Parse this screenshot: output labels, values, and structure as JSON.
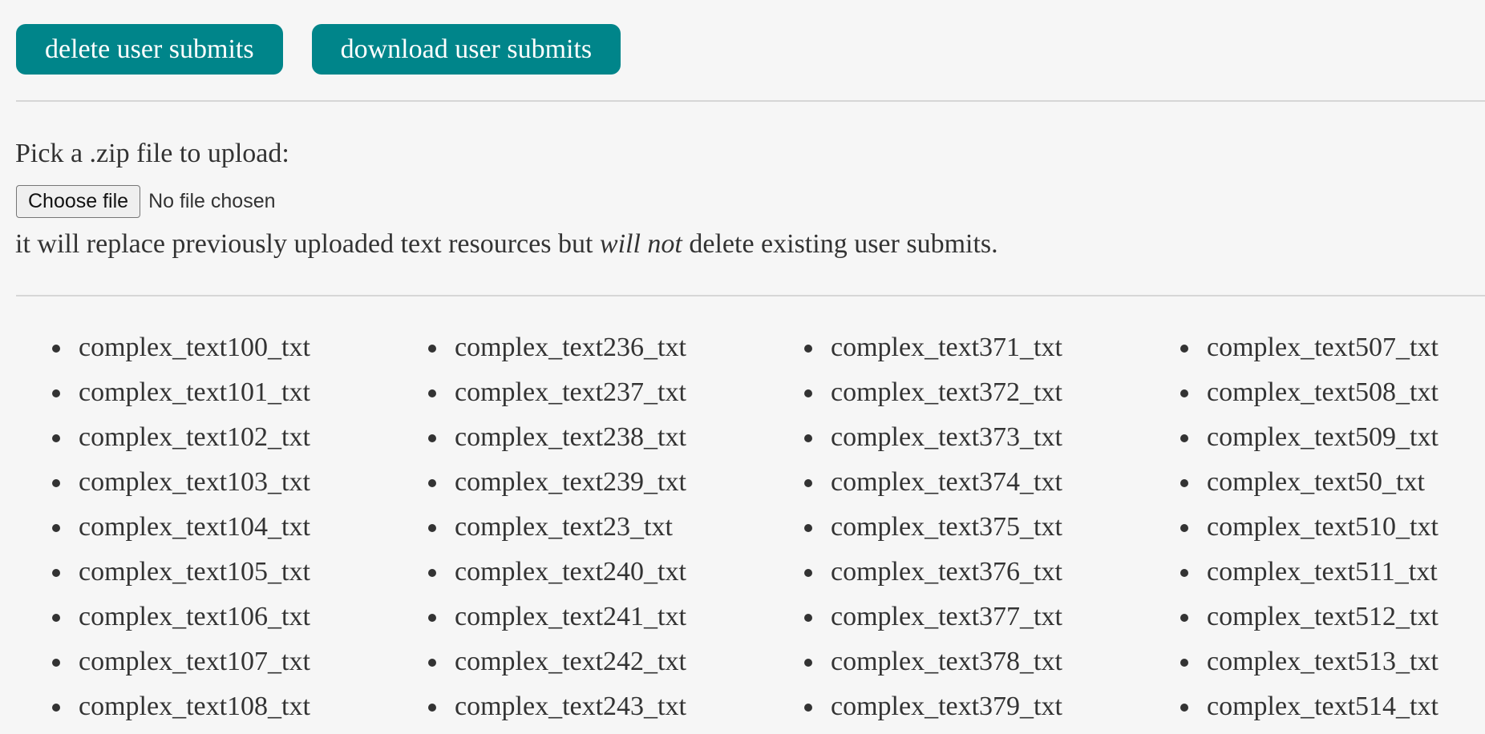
{
  "toolbar": {
    "delete_label": "delete user submits",
    "download_label": "download user submits"
  },
  "upload": {
    "prompt": "Pick a .zip file to upload:",
    "choose_label": "Choose file",
    "status": "No file chosen",
    "note_before": "it will replace previously uploaded text resources but ",
    "note_em": "will not",
    "note_after": " delete existing user submits."
  },
  "colors": {
    "accent": "#00858a",
    "background": "#f6f6f6",
    "text": "#333333"
  },
  "files": {
    "col1": [
      "complex_text100_txt",
      "complex_text101_txt",
      "complex_text102_txt",
      "complex_text103_txt",
      "complex_text104_txt",
      "complex_text105_txt",
      "complex_text106_txt",
      "complex_text107_txt",
      "complex_text108_txt"
    ],
    "col2": [
      "complex_text236_txt",
      "complex_text237_txt",
      "complex_text238_txt",
      "complex_text239_txt",
      "complex_text23_txt",
      "complex_text240_txt",
      "complex_text241_txt",
      "complex_text242_txt",
      "complex_text243_txt"
    ],
    "col3": [
      "complex_text371_txt",
      "complex_text372_txt",
      "complex_text373_txt",
      "complex_text374_txt",
      "complex_text375_txt",
      "complex_text376_txt",
      "complex_text377_txt",
      "complex_text378_txt",
      "complex_text379_txt"
    ],
    "col4": [
      "complex_text507_txt",
      "complex_text508_txt",
      "complex_text509_txt",
      "complex_text50_txt",
      "complex_text510_txt",
      "complex_text511_txt",
      "complex_text512_txt",
      "complex_text513_txt",
      "complex_text514_txt"
    ]
  }
}
